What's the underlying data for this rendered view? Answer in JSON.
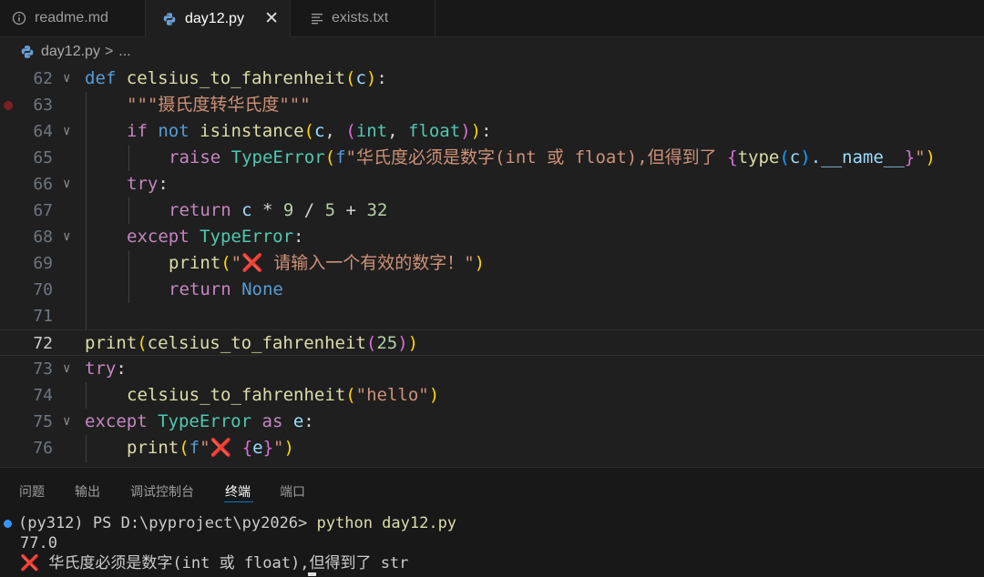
{
  "tabs": [
    {
      "label": "readme.md",
      "icon": "info-icon"
    },
    {
      "label": "day12.py",
      "icon": "python-icon",
      "active": true
    },
    {
      "label": "exists.txt",
      "icon": "text-lines-icon"
    }
  ],
  "breadcrumb": {
    "file": "day12.py",
    "separator": ">",
    "more": "..."
  },
  "editor": {
    "line_numbers": [
      "62",
      "63",
      "64",
      "65",
      "66",
      "67",
      "68",
      "69",
      "70",
      "71",
      "72",
      "73",
      "74",
      "75",
      "76"
    ],
    "current_line": "72"
  },
  "code": {
    "l62": {
      "kw": "def",
      "fn": "celsius_to_fahrenheit",
      "p1": "(",
      "arg": "c",
      "p2": ")",
      "colon": ":"
    },
    "l63": {
      "docstring": "\"\"\"摄氏度转华氏度\"\"\""
    },
    "l64": {
      "kw": "if",
      "not": "not",
      "fn": "isinstance",
      "p1": "(",
      "a": "c",
      "comma": ", ",
      "p2": "(",
      "t1": "int",
      "comma2": ", ",
      "t2": "float",
      "p3": ")",
      "p4": ")",
      "colon": ":"
    },
    "l65": {
      "kw": "raise",
      "cls": "TypeError",
      "p1": "(",
      "fpre": "f",
      "str1": "\"华氏度必须是数字(int 或 float),但得到了 ",
      "b1": "{",
      "fn": "type",
      "p2": "(",
      "a": "c",
      "p3": ")",
      "attr": ".__name__",
      "b2": "}",
      "str2": "\"",
      "p4": ")"
    },
    "l66": {
      "kw": "try",
      "colon": ":"
    },
    "l67": {
      "kw": "return",
      "expr_var": "c",
      "expr_rest": " * ",
      "n1": "9",
      "op2": " / ",
      "n2": "5",
      "op3": " + ",
      "n3": "32"
    },
    "l68": {
      "kw": "except",
      "cls": "TypeError",
      "colon": ":"
    },
    "l69": {
      "fn": "print",
      "p1": "(",
      "q1": "\"",
      "mark": "❌",
      "str": " 请输入一个有效的数字！\"",
      "p2": ")"
    },
    "l70": {
      "kw": "return",
      "val": "None"
    },
    "l72": {
      "fn": "print",
      "p1": "(",
      "fn2": "celsius_to_fahrenheit",
      "p2": "(",
      "n": "25",
      "p3": ")",
      "p4": ")"
    },
    "l73": {
      "kw": "try",
      "colon": ":"
    },
    "l74": {
      "fn": "celsius_to_fahrenheit",
      "p1": "(",
      "str": "\"hello\"",
      "p2": ")"
    },
    "l75": {
      "kw": "except",
      "cls": "TypeError",
      "as": "as",
      "var": "e",
      "colon": ":"
    },
    "l76": {
      "fn": "print",
      "p1": "(",
      "fpre": "f",
      "q1": "\"",
      "mark": "❌",
      "sp": " ",
      "b1": "{",
      "var": "e",
      "b2": "}",
      "q2": "\"",
      "p2": ")"
    }
  },
  "panel": {
    "tabs": [
      "问题",
      "输出",
      "调试控制台",
      "终端",
      "端口"
    ],
    "active_tab": "终端"
  },
  "terminal": {
    "prompt": "(py312) PS D:\\pyproject\\py2026> ",
    "command": "python day12.py",
    "out1": "77.0",
    "out2_mark": "❌",
    "out2": " 华氏度必须是数字(int 或 float),但得到了 str"
  },
  "colors": {
    "background": "#1f1f1f",
    "keyword": "#569cd6",
    "control": "#c586c0",
    "function": "#dcdcaa",
    "class": "#4ec9b0",
    "string": "#ce9178",
    "number": "#b5cea8",
    "variable": "#9cdcfe",
    "accent": "#0078d4"
  }
}
